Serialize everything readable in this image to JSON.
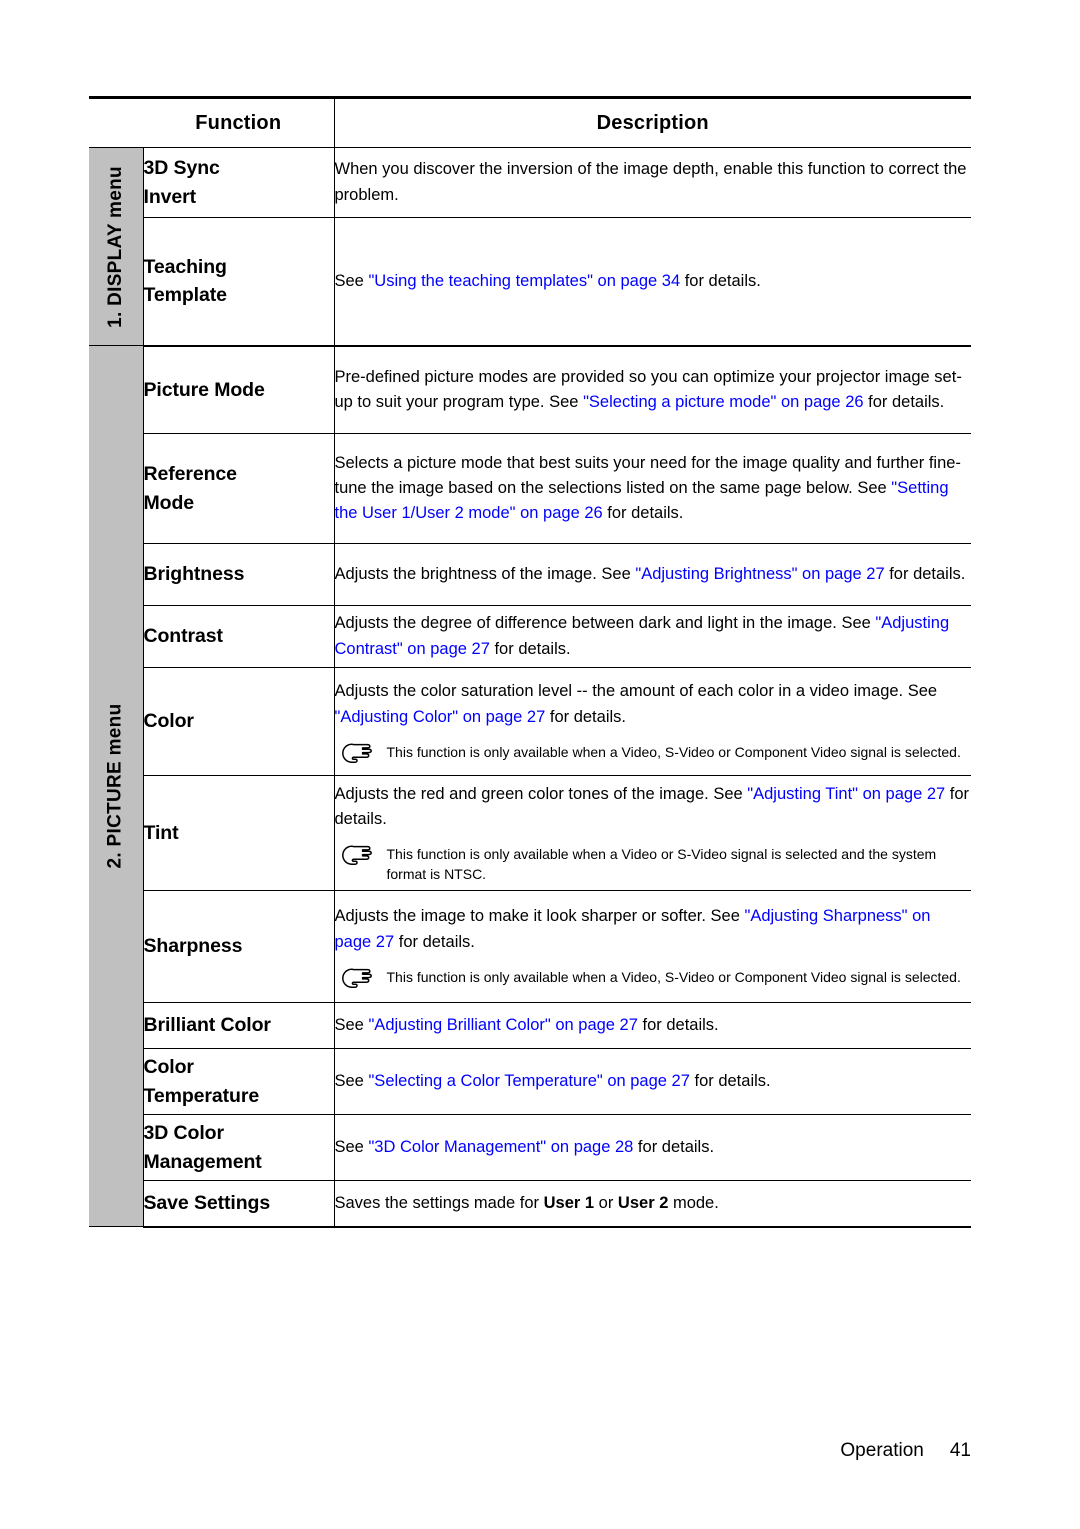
{
  "table": {
    "headers": {
      "function": "Function",
      "description": "Description"
    },
    "sections": [
      {
        "side_label": "1. DISPLAY menu",
        "rows": [
          {
            "function": "3D Sync Invert",
            "function_lines": [
              "3D Sync",
              "Invert"
            ],
            "description_plain": "When you discover the inversion of the image depth, enable this function to correct the problem.",
            "parts": [
              {
                "text": "When you discover the inversion of the image depth, enable this function to correct the problem.",
                "style": "normal"
              }
            ],
            "note": null
          },
          {
            "function": "Teaching Template",
            "function_lines": [
              "Teaching",
              "Template"
            ],
            "description_plain": "See \"Using the teaching templates\" on page 34 for details.",
            "parts": [
              {
                "text": "See ",
                "style": "normal"
              },
              {
                "text": "\"Using the teaching templates\" on page 34",
                "style": "link"
              },
              {
                "text": " for details.",
                "style": "normal"
              }
            ],
            "note": null
          }
        ]
      },
      {
        "side_label": "2. PICTURE menu",
        "rows": [
          {
            "function": "Picture Mode",
            "function_lines": [
              "Picture Mode"
            ],
            "description_plain": "Pre-defined picture modes are provided so you can optimize your projector image set-up to suit your program type. See \"Selecting a picture mode\" on page 26 for details.",
            "parts": [
              {
                "text": "Pre-defined picture modes are provided so you can optimize your projector image set-up to suit your program type. See ",
                "style": "normal"
              },
              {
                "text": "\"Selecting a picture mode\" on page 26",
                "style": "link"
              },
              {
                "text": " for details.",
                "style": "normal"
              }
            ],
            "note": null
          },
          {
            "function": "Reference Mode",
            "function_lines": [
              "Reference",
              "Mode"
            ],
            "description_plain": "Selects a picture mode that best suits your need for the image quality and further fine-tune the image based on the selections listed on the same page below. See \"Setting the User 1/User 2 mode\" on page 26 for details.",
            "parts": [
              {
                "text": "Selects a picture mode that best suits your need for the image quality and further fine-tune the image based on the selections listed on the same page below. See ",
                "style": "normal"
              },
              {
                "text": "\"Setting the User 1/User 2 mode\" on page 26",
                "style": "link"
              },
              {
                "text": " for details.",
                "style": "normal"
              }
            ],
            "note": null
          },
          {
            "function": "Brightness",
            "function_lines": [
              "Brightness"
            ],
            "description_plain": "Adjusts the brightness of the image. See \"Adjusting Brightness\" on page 27 for details.",
            "parts": [
              {
                "text": "Adjusts the brightness of the image. See ",
                "style": "normal"
              },
              {
                "text": "\"Adjusting Brightness\" on page 27",
                "style": "link"
              },
              {
                "text": " for details.",
                "style": "normal"
              }
            ],
            "note": null
          },
          {
            "function": "Contrast",
            "function_lines": [
              "Contrast"
            ],
            "description_plain": "Adjusts the degree of difference between dark and light in the image. See \"Adjusting Contrast\" on page 27 for details.",
            "parts": [
              {
                "text": "Adjusts the degree of difference between dark and light in the image. See ",
                "style": "normal"
              },
              {
                "text": "\"Adjusting Contrast\" on page 27",
                "style": "link"
              },
              {
                "text": " for details.",
                "style": "normal"
              }
            ],
            "note": null
          },
          {
            "function": "Color",
            "function_lines": [
              "Color"
            ],
            "description_plain": "Adjusts the color saturation level -- the amount of each color in a video image. See \"Adjusting Color\" on page 27 for details.",
            "parts": [
              {
                "text": "Adjusts the color saturation level -- the amount of each color in a video image. See ",
                "style": "normal"
              },
              {
                "text": "\"Adjusting Color\" on page 27",
                "style": "link"
              },
              {
                "text": " for details.",
                "style": "normal"
              }
            ],
            "note": "This function is only available when a Video, S-Video or Component Video signal is selected."
          },
          {
            "function": "Tint",
            "function_lines": [
              "Tint"
            ],
            "description_plain": "Adjusts the red and green color tones of the image. See \"Adjusting Tint\" on page 27 for details.",
            "parts": [
              {
                "text": "Adjusts the red and green color tones of the image. See ",
                "style": "normal"
              },
              {
                "text": "\"Adjusting Tint\" on page 27",
                "style": "link"
              },
              {
                "text": " for details.",
                "style": "normal"
              }
            ],
            "note": "This function is only available when a Video or S-Video signal is selected and the system format is NTSC."
          },
          {
            "function": "Sharpness",
            "function_lines": [
              "Sharpness"
            ],
            "description_plain": "Adjusts the image to make it look sharper or softer. See \"Adjusting Sharpness\" on page 27 for details.",
            "parts": [
              {
                "text": "Adjusts the image to make it look sharper or softer. See ",
                "style": "normal"
              },
              {
                "text": "\"Adjusting Sharpness\" on page 27",
                "style": "link"
              },
              {
                "text": " for details.",
                "style": "normal"
              }
            ],
            "note": "This function is only available when a Video, S-Video or Component Video signal is selected."
          },
          {
            "function": "Brilliant Color",
            "function_lines": [
              "Brilliant Color"
            ],
            "description_plain": "See \"Adjusting Brilliant Color\" on page 27 for details.",
            "parts": [
              {
                "text": "See ",
                "style": "normal"
              },
              {
                "text": "\"Adjusting Brilliant Color\" on page 27",
                "style": "link"
              },
              {
                "text": " for details.",
                "style": "normal"
              }
            ],
            "note": null
          },
          {
            "function": "Color Temperature",
            "function_lines": [
              "Color",
              "Temperature"
            ],
            "description_plain": "See \"Selecting a Color Temperature\" on page 27 for details.",
            "parts": [
              {
                "text": "See ",
                "style": "normal"
              },
              {
                "text": "\"Selecting a Color Temperature\" on page 27",
                "style": "link"
              },
              {
                "text": " for details.",
                "style": "normal"
              }
            ],
            "note": null
          },
          {
            "function": "3D Color Management",
            "function_lines": [
              "3D Color",
              "Management"
            ],
            "description_plain": "See \"3D Color Management\" on page 28 for details.",
            "parts": [
              {
                "text": "See ",
                "style": "normal"
              },
              {
                "text": "\"3D Color Management\" on page 28",
                "style": "link"
              },
              {
                "text": " for details.",
                "style": "normal"
              }
            ],
            "note": null
          },
          {
            "function": "Save Settings",
            "function_lines": [
              "Save Settings"
            ],
            "description_plain": "Saves the settings made for User 1 or User 2 mode.",
            "parts": [
              {
                "text": "Saves the settings made for ",
                "style": "normal"
              },
              {
                "text": "User 1",
                "style": "bold"
              },
              {
                "text": " or ",
                "style": "normal"
              },
              {
                "text": "User 2",
                "style": "bold"
              },
              {
                "text": " mode.",
                "style": "normal"
              }
            ],
            "note": null
          }
        ]
      }
    ]
  },
  "footer": {
    "chapter": "Operation",
    "page_number": "41"
  },
  "icons": {
    "note": "pointing-hand-icon"
  },
  "colors": {
    "link": "#0000ff",
    "sidebar_gray": "#c0c0c0",
    "text": "#000000"
  }
}
